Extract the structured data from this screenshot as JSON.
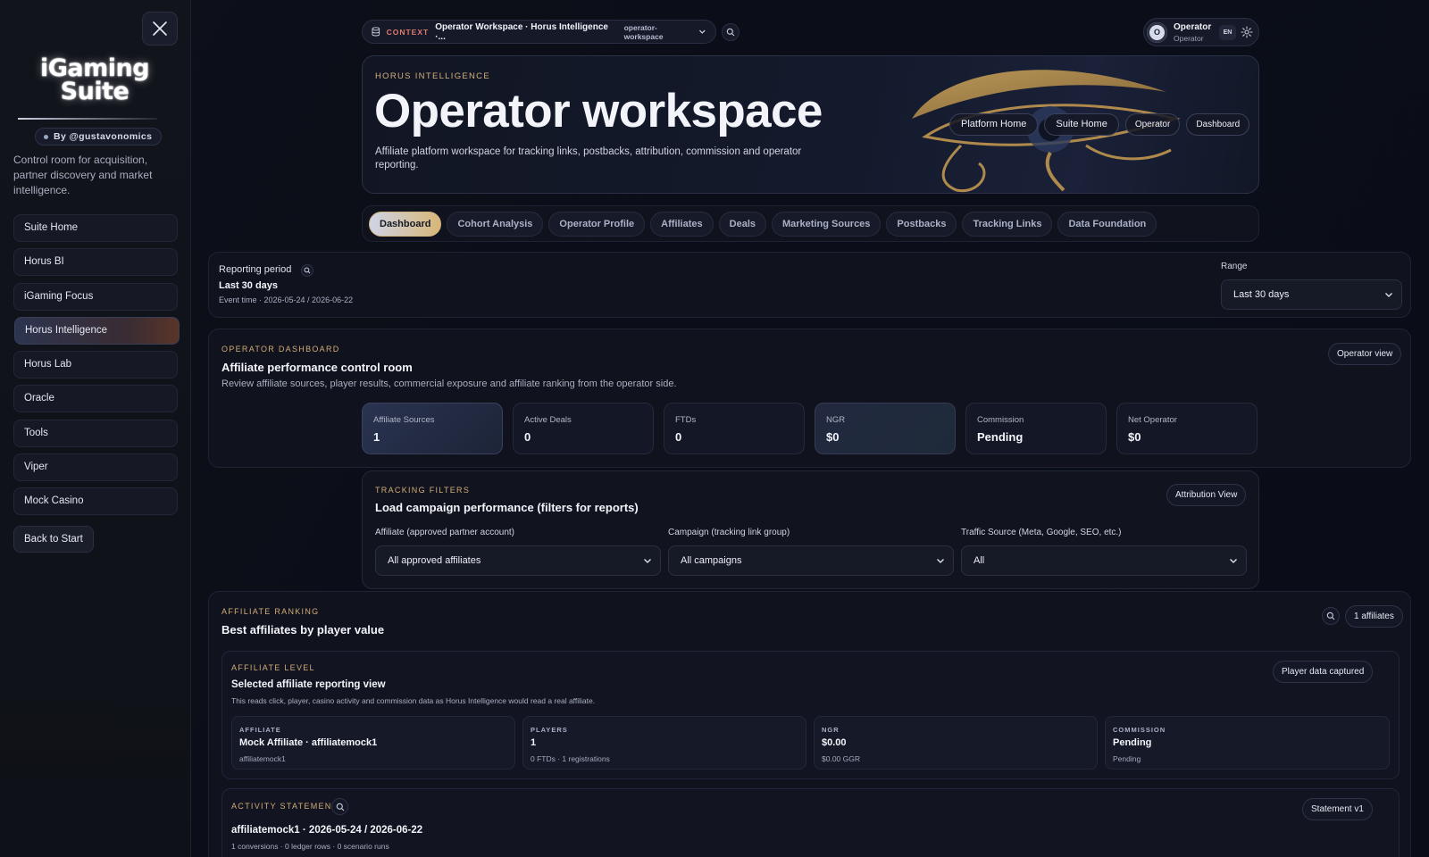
{
  "sidebar": {
    "brand_line1": "iGaming",
    "brand_line2": "Suite",
    "by_label": "By @gustavonomics",
    "tagline": "Control room for acquisition, partner discovery and market intelligence.",
    "items": [
      {
        "label": "Suite Home"
      },
      {
        "label": "Horus BI"
      },
      {
        "label": "iGaming Focus"
      },
      {
        "label": "Horus Intelligence",
        "active": true
      },
      {
        "label": "Horus Lab"
      },
      {
        "label": "Oracle"
      },
      {
        "label": "Tools"
      },
      {
        "label": "Viper"
      },
      {
        "label": "Mock Casino"
      }
    ],
    "back_label": "Back to Start"
  },
  "topbar": {
    "context_label": "CONTEXT",
    "context_title": "Operator Workspace · Horus Intelligence ·...",
    "context_slug": "operator-workspace",
    "user_initial": "O",
    "user_name": "Operator",
    "user_role": "Operator",
    "lang": "EN"
  },
  "hero": {
    "eyebrow": "HORUS INTELLIGENCE",
    "title": "Operator workspace",
    "description": "Affiliate platform workspace for tracking links, postbacks, attribution, commission and operator reporting.",
    "nav": [
      "Platform Home",
      "Suite Home",
      "Operator",
      "Dashboard"
    ]
  },
  "tabs": [
    {
      "label": "Dashboard",
      "active": true
    },
    {
      "label": "Cohort Analysis"
    },
    {
      "label": "Operator Profile"
    },
    {
      "label": "Affiliates"
    },
    {
      "label": "Deals"
    },
    {
      "label": "Marketing Sources"
    },
    {
      "label": "Postbacks"
    },
    {
      "label": "Tracking Links"
    },
    {
      "label": "Data Foundation"
    }
  ],
  "period": {
    "label": "Reporting period",
    "value": "Last 30 days",
    "event_time": "Event time · 2026-05-24 / 2026-06-22",
    "range_label": "Range",
    "range_value": "Last 30 days"
  },
  "dashboard": {
    "eyebrow": "OPERATOR DASHBOARD",
    "title": "Affiliate performance control room",
    "description": "Review affiliate sources, player results, commercial exposure and affiliate ranking from the operator side.",
    "view_button": "Operator view",
    "kpis": [
      {
        "label": "Affiliate Sources",
        "value": "1"
      },
      {
        "label": "Active Deals",
        "value": "0"
      },
      {
        "label": "FTDs",
        "value": "0"
      },
      {
        "label": "NGR",
        "value": "$0"
      },
      {
        "label": "Commission",
        "value": "Pending"
      },
      {
        "label": "Net Operator",
        "value": "$0"
      }
    ]
  },
  "filters": {
    "eyebrow": "TRACKING FILTERS",
    "title": "Load campaign performance (filters for reports)",
    "view_button": "Attribution View",
    "affiliate_label": "Affiliate (approved partner account)",
    "affiliate_value": "All approved affiliates",
    "campaign_label": "Campaign (tracking link group)",
    "campaign_value": "All campaigns",
    "source_label": "Traffic Source (Meta, Google, SEO, etc.)",
    "source_value": "All"
  },
  "ranking": {
    "eyebrow": "AFFILIATE RANKING",
    "title": "Best affiliates by player value",
    "count_badge": "1 affiliates",
    "level": {
      "eyebrow": "AFFILIATE LEVEL",
      "title": "Selected affiliate reporting view",
      "description": "This reads click, player, casino activity and commission data as Horus Intelligence would read a real affiliate.",
      "badge": "Player data captured",
      "cells": [
        {
          "label": "AFFILIATE",
          "value": "Mock Affiliate · affiliatemock1",
          "sub": "affiliatemock1"
        },
        {
          "label": "PLAYERS",
          "value": "1",
          "sub": "0 FTDs · 1 registrations"
        },
        {
          "label": "NGR",
          "value": "$0.00",
          "sub": "$0.00 GGR"
        },
        {
          "label": "COMMISSION",
          "value": "Pending",
          "sub": "Pending"
        }
      ]
    },
    "statement": {
      "eyebrow": "ACTIVITY STATEMENT",
      "badge": "Statement v1",
      "title": "affiliatemock1 · 2026-05-24 / 2026-06-22",
      "sub": "1 conversions · 0 ledger rows · 0 scenario runs"
    }
  }
}
